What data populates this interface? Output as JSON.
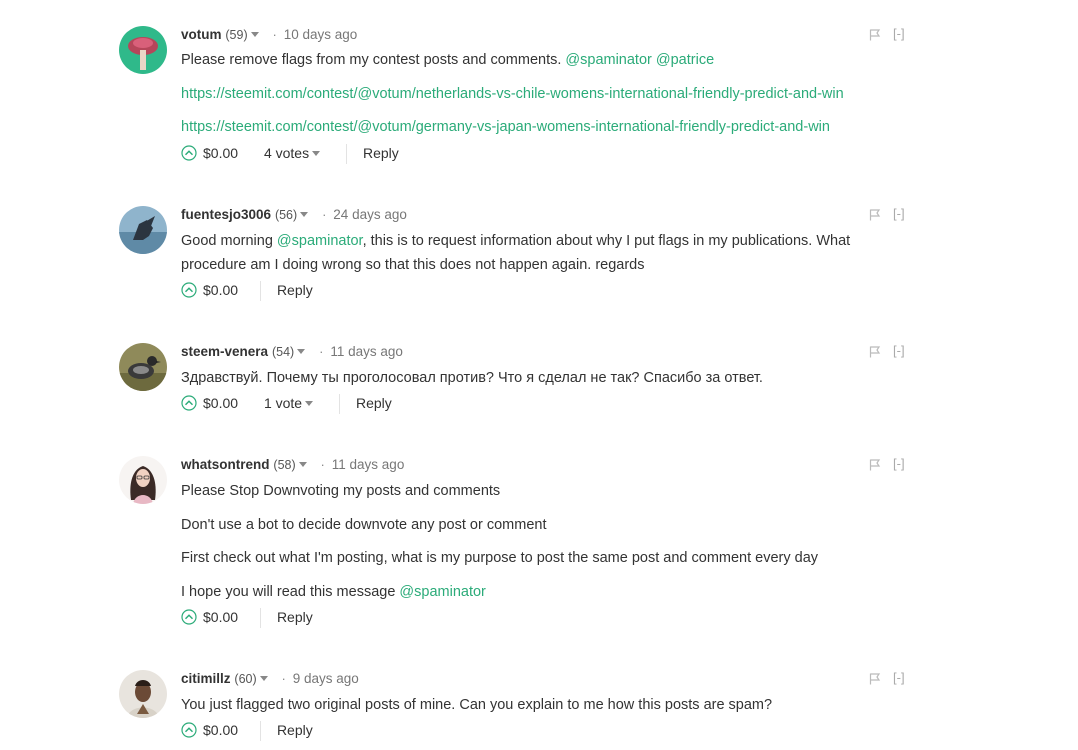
{
  "comments": [
    {
      "author": "votum",
      "reputation": "(59)",
      "time": "10 days ago",
      "collapse_label": "[-]",
      "lines": [
        {
          "text": "Please remove flags from my contest posts and comments. ",
          "mentions": [
            "@spaminator",
            "@patrice"
          ]
        },
        {
          "link": "https://steemit.com/contest/@votum/netherlands-vs-chile-womens-international-friendly-predict-and-win"
        },
        {
          "link": "https://steemit.com/contest/@votum/germany-vs-japan-womens-international-friendly-predict-and-win"
        }
      ],
      "payout": "$0.00",
      "votes": "4 votes",
      "reply_label": "Reply"
    },
    {
      "author": "fuentesjo3006",
      "reputation": "(56)",
      "time": "24 days ago",
      "collapse_label": "[-]",
      "body_pre": "Good morning ",
      "body_mention": "@spaminator",
      "body_post": ", this is to request information about why I put flags in my publications. What procedure am I doing wrong so that this does not happen again. regards",
      "payout": "$0.00",
      "reply_label": "Reply"
    },
    {
      "author": "steem-venera",
      "reputation": "(54)",
      "time": "11 days ago",
      "collapse_label": "[-]",
      "body": "Здравствуй. Почему ты проголосовал против? Что я сделал не так? Спасибо за ответ.",
      "payout": "$0.00",
      "votes": "1 vote",
      "reply_label": "Reply"
    },
    {
      "author": "whatsontrend",
      "reputation": "(58)",
      "time": "11 days ago",
      "collapse_label": "[-]",
      "lines": [
        "Please Stop Downvoting my posts and comments",
        "Don't use a bot to decide downvote any post or comment",
        "First check out what I'm posting, what is my purpose to post the same post and comment every day",
        "I hope you will read this message "
      ],
      "last_mention": "@spaminator",
      "payout": "$0.00",
      "reply_label": "Reply"
    },
    {
      "author": "citimillz",
      "reputation": "(60)",
      "time": "9 days ago",
      "collapse_label": "[-]",
      "body": "You just flagged two original posts of mine. Can you explain to me how this posts are spam?",
      "payout": "$0.00",
      "reply_label": "Reply"
    }
  ],
  "colors": {
    "link": "#2bab79",
    "text": "#333333",
    "muted": "#888888"
  }
}
